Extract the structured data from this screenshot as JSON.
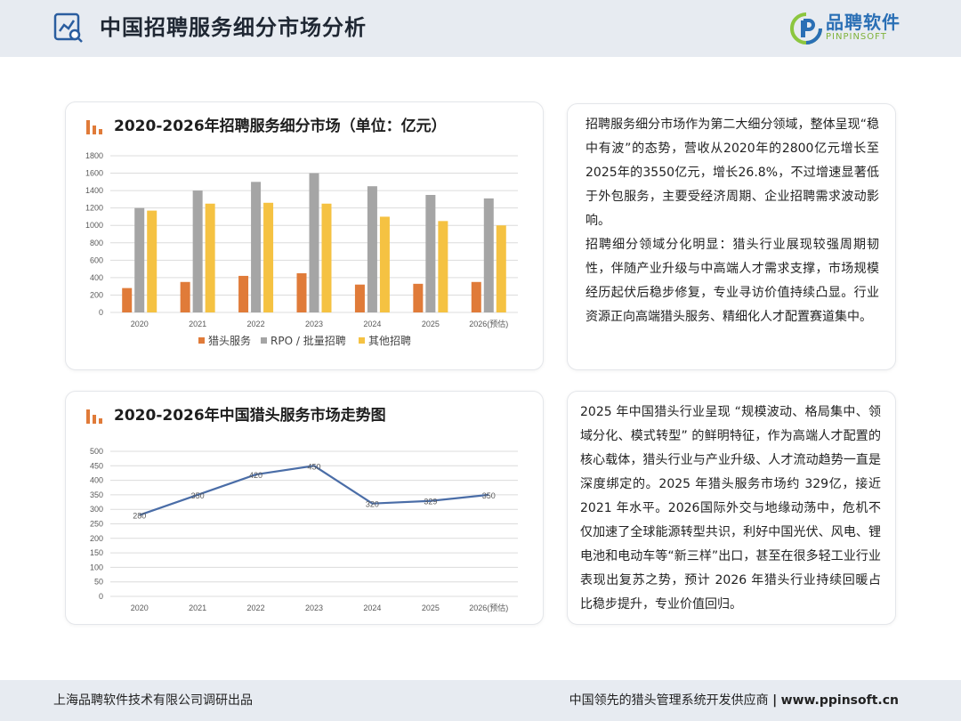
{
  "header": {
    "title": "中国招聘服务细分市场分析",
    "logo_cn": "品聘软件",
    "logo_en": "PINPINSOFT"
  },
  "chart1": {
    "title": "2020-2026年招聘服务细分市场（单位：亿元）"
  },
  "chart2": {
    "title": "2020-2026年中国猎头服务市场走势图"
  },
  "chart_data": [
    {
      "type": "bar",
      "categories": [
        "2020",
        "2021",
        "2022",
        "2023",
        "2024",
        "2025",
        "2026(预估)"
      ],
      "series": [
        {
          "name": "猎头服务",
          "values": [
            280,
            350,
            420,
            450,
            320,
            329,
            350
          ],
          "color": "#e07b39"
        },
        {
          "name": "RPO / 批量招聘",
          "values": [
            1200,
            1400,
            1500,
            1600,
            1450,
            1350,
            1310
          ],
          "color": "#a5a5a5"
        },
        {
          "name": "其他招聘",
          "values": [
            1170,
            1250,
            1260,
            1250,
            1100,
            1050,
            1000
          ],
          "color": "#f5c242"
        }
      ],
      "yticks": [
        0,
        200,
        400,
        600,
        800,
        1000,
        1200,
        1400,
        1600,
        1800
      ],
      "ylim": [
        0,
        1800
      ],
      "grid": true,
      "legend": "bottom"
    },
    {
      "type": "line",
      "categories": [
        "2020",
        "2021",
        "2022",
        "2023",
        "2024",
        "2025",
        "2026(预估)"
      ],
      "series": [
        {
          "values": [
            280,
            350,
            420,
            450,
            320,
            329,
            350
          ],
          "color": "#4a6da7"
        }
      ],
      "data_labels": [
        "280",
        "350",
        "420",
        "450",
        "320",
        "329",
        "350"
      ],
      "yticks": [
        0,
        50,
        100,
        150,
        200,
        250,
        300,
        350,
        400,
        450,
        500
      ],
      "ylim": [
        0,
        500
      ],
      "grid": true
    }
  ],
  "text1": {
    "p1": "招聘服务细分市场作为第二大细分领域，整体呈现“稳中有波”的态势，营收从2020年的2800亿元增长至2025年的3550亿元，增长26.8%，不过增速显著低于外包服务，主要受经济周期、企业招聘需求波动影响。",
    "p2": "招聘细分领域分化明显：猎头行业展现较强周期韧性，伴随产业升级与中高端人才需求支撑，市场规模经历起伏后稳步修复，专业寻访价值持续凸显。行业资源正向高端猎头服务、精细化人才配置赛道集中。"
  },
  "text2": {
    "p1": "2025 年中国猎头行业呈现 “规模波动、格局集中、领域分化、模式转型” 的鲜明特征，作为高端人才配置的核心载体，猎头行业与产业升级、人才流动趋势一直是深度绑定的。2025 年猎头服务市场约 329亿，接近 2021 年水平。2026国际外交与地缘动荡中，危机不仅加速了全球能源转型共识，利好中国光伏、风电、锂电池和电动车等“新三样”出口，甚至在很多轻工业行业表现出复苏之势，预计 2026 年猎头行业持续回暖占比稳步提升，专业价值回归。"
  },
  "footer": {
    "left": "上海品聘软件技术有限公司调研出品",
    "right_text": "中国领先的猎头管理系统开发供应商",
    "right_sep": "|",
    "right_url": "www.ppinsoft.cn"
  }
}
